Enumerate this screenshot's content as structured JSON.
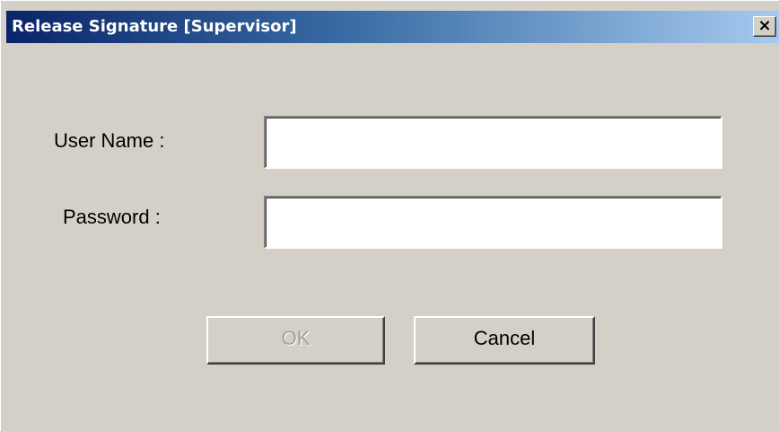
{
  "window": {
    "title": "Release Signature [Supervisor]",
    "close_label": "×"
  },
  "form": {
    "username_label": "User Name :",
    "username_value": "",
    "password_label": "Password :",
    "password_value": ""
  },
  "buttons": {
    "ok_label": "OK",
    "ok_enabled": false,
    "cancel_label": "Cancel"
  }
}
